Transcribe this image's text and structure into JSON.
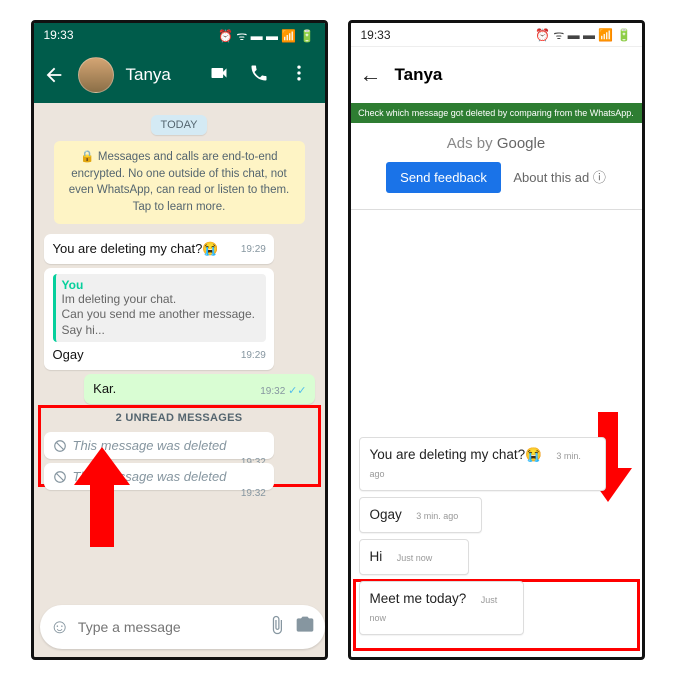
{
  "statusTime": "19:33",
  "phone1": {
    "contactName": "Tanya",
    "dayLabel": "TODAY",
    "encryption": "🔒 Messages and calls are end-to-end encrypted. No one outside of this chat, not even WhatsApp, can read or listen to them. Tap to learn more.",
    "msg1": {
      "text": "You are deleting my chat?😭",
      "time": "19:29"
    },
    "msg2": {
      "quotedName": "You",
      "quotedText": "Im deleting your chat.\nCan you send me another message.\nSay hi...",
      "text": "Ogay",
      "time": "19:29"
    },
    "msg3": {
      "text": "Kar.",
      "time": "19:32"
    },
    "unreadLabel": "2 UNREAD MESSAGES",
    "deleted1": {
      "text": "This message was deleted",
      "time": "19:32"
    },
    "deleted2": {
      "text": "This message was deleted",
      "time": "19:32"
    },
    "inputPlaceholder": "Type a message"
  },
  "phone2": {
    "contactName": "Tanya",
    "banner": "Check which message got deleted by comparing from the WhatsApp.",
    "adsTitle": "Ads by Google",
    "sendFeedback": "Send feedback",
    "aboutAd": "About this ad ⓘ",
    "msg1": {
      "text": "You are deleting my chat?😭",
      "time": "3 min. ago"
    },
    "msg2": {
      "text": "Ogay",
      "time": "3 min. ago"
    },
    "msg3": {
      "text": "Hi",
      "time": "Just now"
    },
    "msg4": {
      "text": "Meet me today?",
      "time": "Just now"
    }
  }
}
